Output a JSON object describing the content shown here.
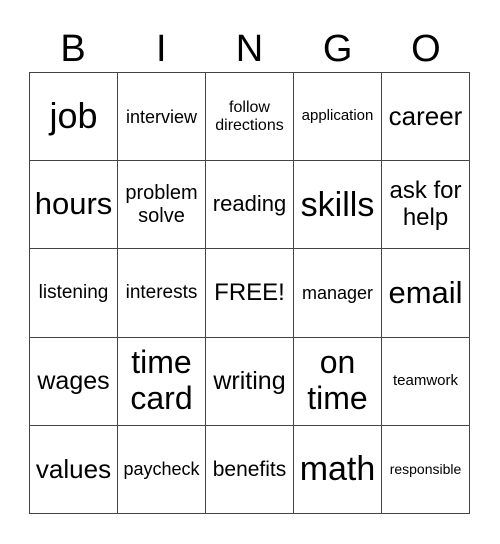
{
  "header": [
    "B",
    "I",
    "N",
    "G",
    "O"
  ],
  "cells": [
    "job",
    "interview",
    "follow directions",
    "application",
    "career",
    "hours",
    "problem solve",
    "reading",
    "skills",
    "ask for help",
    "listening",
    "interests",
    "FREE!",
    "manager",
    "email",
    "wages",
    "time card",
    "writing",
    "on time",
    "teamwork",
    "values",
    "paycheck",
    "benefits",
    "math",
    "responsible"
  ]
}
